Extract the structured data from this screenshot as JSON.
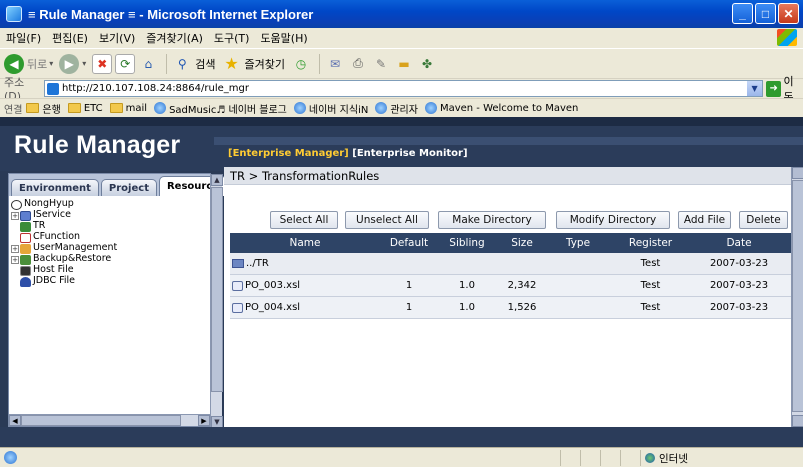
{
  "window": {
    "title": "≡ Rule Manager ≡ - Microsoft Internet Explorer"
  },
  "menu": [
    "파일(F)",
    "편집(E)",
    "보기(V)",
    "즐겨찾기(A)",
    "도구(T)",
    "도움말(H)"
  ],
  "toolbar": {
    "back_label": "뒤로",
    "search_label": "검색",
    "favorites_label": "즐겨찾기"
  },
  "address": {
    "label": "주소(D)",
    "url": "http://210.107.108.24:8864/rule_mgr",
    "go_label": "이동"
  },
  "links": {
    "label": "연결",
    "items": [
      "은행",
      "ETC",
      "mail",
      "SadMusic♬ 네이버 블로그",
      "네이버 지식iN",
      "관리자",
      "Maven - Welcome to Maven"
    ]
  },
  "app": {
    "logo": "Rule Manager",
    "nav_active": "[Enterprise Manager]",
    "nav_other": "[Enterprise Monitor]"
  },
  "tabs": [
    "Environment",
    "Project",
    "Resource"
  ],
  "tree": {
    "root": "NongHyup",
    "items": [
      "IService",
      "TR",
      "CFunction",
      "UserManagement",
      "Backup&Restore",
      "Host File",
      "JDBC File"
    ]
  },
  "breadcrumb": "TR > TransformationRules",
  "buttons": {
    "select_all": "Select All",
    "unselect_all": "Unselect All",
    "make_directory": "Make Directory",
    "modify_directory": "Modify Directory",
    "add_file": "Add File",
    "delete": "Delete"
  },
  "table": {
    "headers": [
      "Name",
      "Default",
      "Sibling",
      "Size",
      "Type",
      "Register",
      "Date"
    ],
    "rows": [
      {
        "name": "../TR",
        "default": "",
        "sibling": "",
        "size": "",
        "type": "",
        "register": "Test",
        "date": "2007-03-23"
      },
      {
        "name": "PO_003.xsl",
        "default": "1",
        "sibling": "1.0",
        "size": "2,342",
        "type": "",
        "register": "Test",
        "date": "2007-03-23"
      },
      {
        "name": "PO_004.xsl",
        "default": "1",
        "sibling": "1.0",
        "size": "1,526",
        "type": "",
        "register": "Test",
        "date": "2007-03-23"
      }
    ]
  },
  "status": {
    "zone": "인터넷"
  },
  "colors": {
    "header_bg": "#2b3c5a",
    "nav_active": "#ffcc33",
    "grid_header": "#2e4466"
  }
}
